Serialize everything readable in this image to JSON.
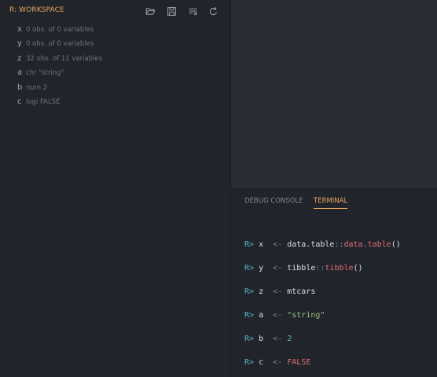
{
  "workspace": {
    "title": "R: WORKSPACE",
    "toolbar": {
      "open_icon": "folder-open-icon",
      "save_icon": "save-icon",
      "clear_icon": "clear-all-icon",
      "refresh_icon": "refresh-icon"
    },
    "variables": [
      {
        "name": "x",
        "desc": "0 obs. of 0 variables"
      },
      {
        "name": "y",
        "desc": "0 obs. of 0 variables"
      },
      {
        "name": "z",
        "desc": "32 obs. of 11 variables"
      },
      {
        "name": "a",
        "desc": "chr \"string\""
      },
      {
        "name": "b",
        "desc": "num 2"
      },
      {
        "name": "c",
        "desc": "logi FALSE"
      }
    ]
  },
  "panel": {
    "tabs": [
      {
        "label": "DEBUG CONSOLE",
        "active": false
      },
      {
        "label": "TERMINAL",
        "active": true
      }
    ],
    "terminal": {
      "lines": [
        {
          "prompt": "R>",
          "var": "x",
          "assign": "<-",
          "tokens": [
            {
              "t": "data.table",
              "c": "plain"
            },
            {
              "t": "::",
              "c": "ns"
            },
            {
              "t": "data.table",
              "c": "func"
            },
            {
              "t": "()",
              "c": "paren"
            }
          ]
        },
        {
          "prompt": "R>",
          "var": "y",
          "assign": "<-",
          "tokens": [
            {
              "t": "tibble",
              "c": "plain"
            },
            {
              "t": "::",
              "c": "ns"
            },
            {
              "t": "tibble",
              "c": "func"
            },
            {
              "t": "()",
              "c": "paren"
            }
          ]
        },
        {
          "prompt": "R>",
          "var": "z",
          "assign": "<-",
          "tokens": [
            {
              "t": "mtcars",
              "c": "plain"
            }
          ]
        },
        {
          "prompt": "R>",
          "var": "a",
          "assign": "<-",
          "tokens": [
            {
              "t": "\"string\"",
              "c": "str"
            }
          ]
        },
        {
          "prompt": "R>",
          "var": "b",
          "assign": "<-",
          "tokens": [
            {
              "t": "2",
              "c": "num"
            }
          ]
        },
        {
          "prompt": "R>",
          "var": "c",
          "assign": "<-",
          "tokens": [
            {
              "t": "FALSE",
              "c": "bool"
            }
          ]
        }
      ]
    }
  },
  "colors": {
    "accent": "#e8a45c",
    "sidebar_bg": "#21252b",
    "editor_bg": "#282c34"
  }
}
